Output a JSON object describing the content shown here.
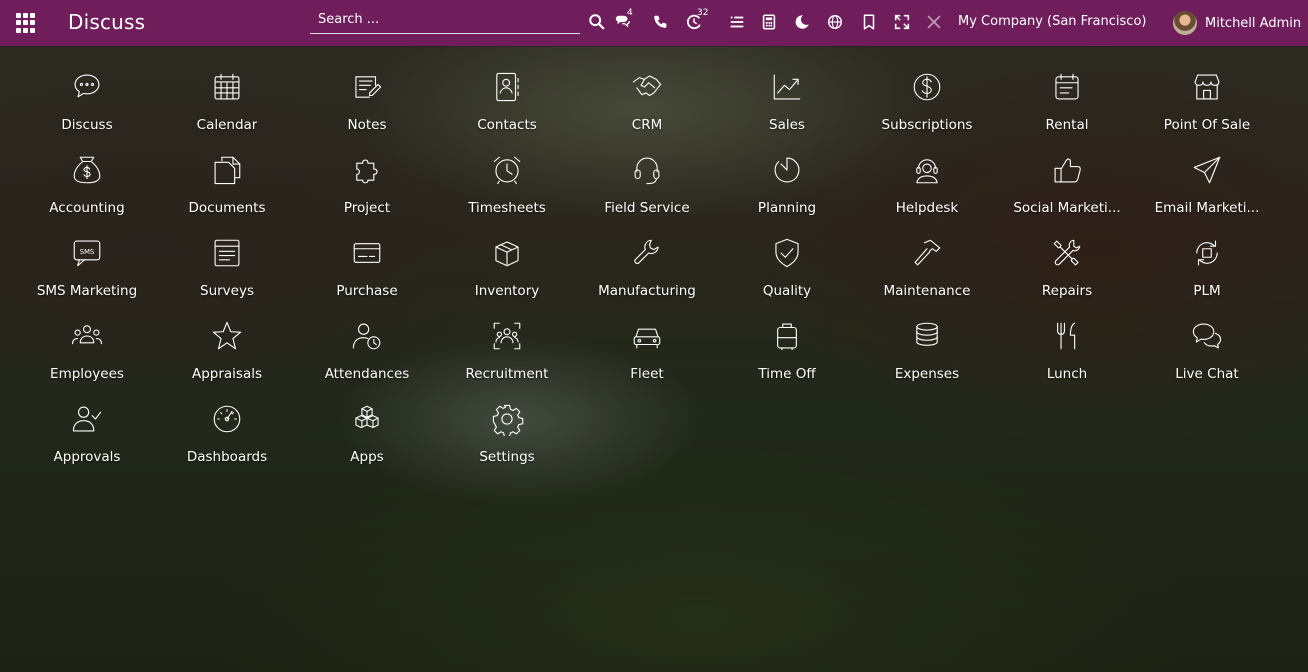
{
  "navbar": {
    "brand": "Discuss",
    "search_placeholder": "Search ...",
    "messages_count": "4",
    "activities_count": "32",
    "company": "My Company (San Francisco)",
    "user_name": "Mitchell Admin",
    "color": "#6f1d5b"
  },
  "apps": [
    {
      "label": "Discuss",
      "icon": "chat-bubble-icon"
    },
    {
      "label": "Calendar",
      "icon": "calendar-icon"
    },
    {
      "label": "Notes",
      "icon": "notes-icon"
    },
    {
      "label": "Contacts",
      "icon": "contacts-icon"
    },
    {
      "label": "CRM",
      "icon": "handshake-icon"
    },
    {
      "label": "Sales",
      "icon": "trend-chart-icon"
    },
    {
      "label": "Subscriptions",
      "icon": "dollar-circle-icon"
    },
    {
      "label": "Rental",
      "icon": "rental-calendar-icon"
    },
    {
      "label": "Point Of Sale",
      "icon": "store-icon"
    },
    {
      "label": "Accounting",
      "icon": "money-bag-icon"
    },
    {
      "label": "Documents",
      "icon": "documents-icon"
    },
    {
      "label": "Project",
      "icon": "puzzle-icon"
    },
    {
      "label": "Timesheets",
      "icon": "alarm-clock-icon"
    },
    {
      "label": "Field Service",
      "icon": "headset-icon"
    },
    {
      "label": "Planning",
      "icon": "planning-dial-icon"
    },
    {
      "label": "Helpdesk",
      "icon": "helpdesk-icon"
    },
    {
      "label": "Social Marketi...",
      "icon": "thumbs-up-icon"
    },
    {
      "label": "Email Marketi...",
      "icon": "paper-plane-icon"
    },
    {
      "label": "SMS Marketing",
      "icon": "sms-icon"
    },
    {
      "label": "Surveys",
      "icon": "survey-form-icon"
    },
    {
      "label": "Purchase",
      "icon": "credit-card-icon"
    },
    {
      "label": "Inventory",
      "icon": "box-icon"
    },
    {
      "label": "Manufacturing",
      "icon": "wrench-icon"
    },
    {
      "label": "Quality",
      "icon": "shield-check-icon"
    },
    {
      "label": "Maintenance",
      "icon": "hammer-icon"
    },
    {
      "label": "Repairs",
      "icon": "tools-icon"
    },
    {
      "label": "PLM",
      "icon": "plm-cycle-icon"
    },
    {
      "label": "Employees",
      "icon": "people-group-icon"
    },
    {
      "label": "Appraisals",
      "icon": "star-icon"
    },
    {
      "label": "Attendances",
      "icon": "user-clock-icon"
    },
    {
      "label": "Recruitment",
      "icon": "recruitment-icon"
    },
    {
      "label": "Fleet",
      "icon": "car-icon"
    },
    {
      "label": "Time Off",
      "icon": "suitcase-icon"
    },
    {
      "label": "Expenses",
      "icon": "coin-stack-icon"
    },
    {
      "label": "Lunch",
      "icon": "fork-knife-icon"
    },
    {
      "label": "Live Chat",
      "icon": "live-chat-icon"
    },
    {
      "label": "Approvals",
      "icon": "user-check-icon"
    },
    {
      "label": "Dashboards",
      "icon": "gauge-icon"
    },
    {
      "label": "Apps",
      "icon": "cubes-icon"
    },
    {
      "label": "Settings",
      "icon": "gear-icon"
    }
  ]
}
